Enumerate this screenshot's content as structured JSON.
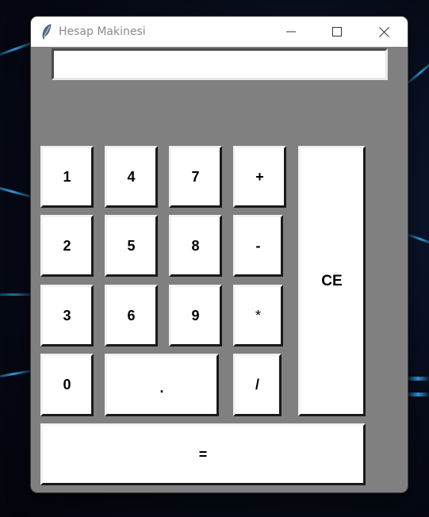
{
  "window": {
    "title": "Hesap Makinesi",
    "controls": [
      "minimize-icon",
      "maximize-icon",
      "close-icon"
    ]
  },
  "display": {
    "value": ""
  },
  "buttons": {
    "one": "1",
    "four": "4",
    "seven": "7",
    "plus": "+",
    "clear": "CE",
    "two": "2",
    "five": "5",
    "eight": "8",
    "minus": "-",
    "three": "3",
    "six": "6",
    "nine": "9",
    "multiply": "*",
    "zero": "0",
    "dot": ".",
    "divide": "/",
    "equals": "="
  },
  "colors": {
    "window_bg": "#808080",
    "button_bg": "#ffffff",
    "text": "#000000"
  }
}
